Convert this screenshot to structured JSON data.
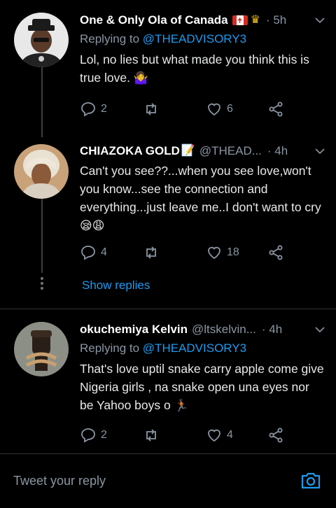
{
  "tweets": [
    {
      "name": "One & Only Ola of Canada",
      "handle": "",
      "time": "· 5h",
      "reply_label": "Replying to",
      "reply_to": "@THEADVISORY3",
      "text": "Lol, no lies but what made you think this is true love.",
      "emoji": "🤷‍♀️",
      "replies": "2",
      "retweets": "",
      "likes": "6"
    },
    {
      "name": "CHIAZOKA GOLD",
      "handle": "@THEAD...",
      "time": "· 4h",
      "text": "Can't you see??...when you see love,won't you know...see the connection and everything...just leave me..I don't want to cry",
      "emoji": "😪😩",
      "replies": "4",
      "retweets": "",
      "likes": "18",
      "show_replies": "Show replies"
    },
    {
      "name": "okuchemiya Kelvin",
      "handle": "@ltskelvin...",
      "time": "· 4h",
      "reply_label": "Replying to",
      "reply_to": "@THEADVISORY3",
      "text": "That's love uptil snake carry apple come give Nigeria girls , na snake open una eyes nor be Yahoo boys o",
      "emoji": "🏃🏿",
      "replies": "2",
      "retweets": "",
      "likes": "4"
    }
  ],
  "composer": {
    "placeholder": "Tweet your reply"
  },
  "icons": [
    "chevron-down-icon",
    "reply-icon",
    "retweet-icon",
    "like-icon",
    "share-icon",
    "camera-icon"
  ],
  "colors": {
    "accent": "#1d9bf0",
    "background": "#000000",
    "secondary_text": "#8a96a3"
  }
}
